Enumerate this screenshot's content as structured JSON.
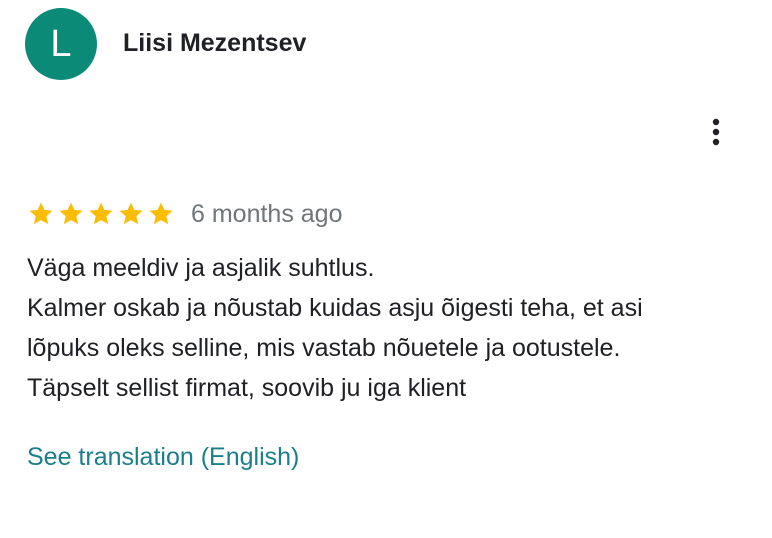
{
  "reviewer": {
    "initial": "L",
    "name": "Liisi Mezentsev",
    "avatar_color": "#0b8a78"
  },
  "menu": {
    "icon": "more-vert-icon"
  },
  "rating": {
    "stars": 5,
    "max_stars": 5,
    "star_color": "#fbbc04",
    "date": "6 months ago"
  },
  "review": {
    "lines": [
      "Väga meeldiv ja asjalik suhtlus.",
      "Kalmer oskab ja nõustab kuidas asju õigesti teha, et asi",
      "lõpuks oleks selline, mis vastab nõuetele ja ootustele.",
      "Täpselt sellist firmat, soovib ju iga klient"
    ]
  },
  "translation": {
    "link_label": "See translation (English)",
    "link_color": "#1a7f8a"
  }
}
